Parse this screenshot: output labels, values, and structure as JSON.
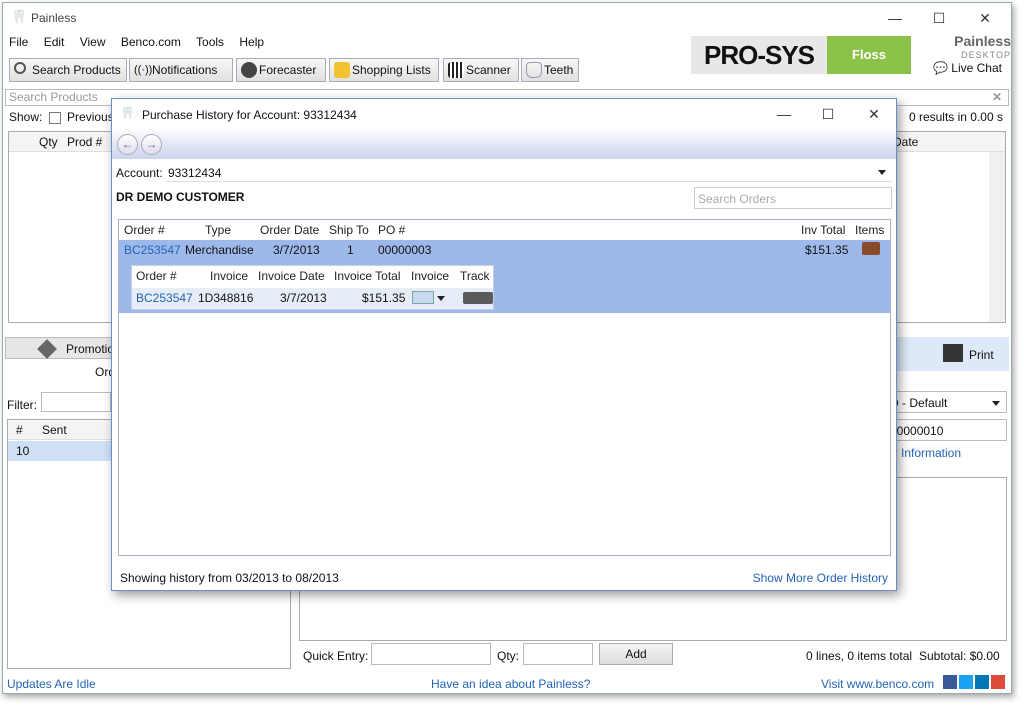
{
  "app": {
    "title": "Painless"
  },
  "window_controls": {
    "minimize": "—",
    "maximize": "☐",
    "close": "✕"
  },
  "menu": [
    "File",
    "Edit",
    "View",
    "Benco.com",
    "Tools",
    "Help"
  ],
  "toolbar": {
    "search_products": "Search Products",
    "notifications": "Notifications",
    "forecaster": "Forecaster",
    "shopping_lists": "Shopping Lists",
    "scanner": "Scanner",
    "teeth": "Teeth"
  },
  "banner": {
    "prosys": "PRO-SYS",
    "floss": "Floss",
    "painless": "Painless",
    "desktop": "DESKTOP",
    "live_chat": "Live Chat"
  },
  "search": {
    "placeholder": "Search Products",
    "results": "0 results in 0.00 s"
  },
  "show": {
    "label": "Show:",
    "previous": "Previous I"
  },
  "product_grid": {
    "qty": "Qty",
    "prod": "Prod #",
    "date": "Date"
  },
  "promotions": {
    "label": "Promotio",
    "order_label": "Ord"
  },
  "filter": {
    "label": "Filter:"
  },
  "sent_grid": {
    "hash": "#",
    "sent": "Sent",
    "row_num": "10"
  },
  "right_panel": {
    "print": "Print",
    "default_select": "D - Default",
    "number": "00000010",
    "info_link": "er Information"
  },
  "quick_entry": {
    "label": "Quick Entry:",
    "qty_label": "Qty:",
    "add": "Add",
    "totals": "0 lines, 0 items total",
    "subtotal": "Subtotal:  $0.00"
  },
  "status": {
    "updates": "Updates Are Idle",
    "idea": "Have an idea about Painless?",
    "visit": "Visit www.benco.com"
  },
  "dialog": {
    "title": "Purchase History for Account: 93312434",
    "account_label": "Account:",
    "account_value": "93312434",
    "customer": "DR DEMO CUSTOMER",
    "search_orders_placeholder": "Search Orders",
    "headers": {
      "order": "Order #",
      "type": "Type",
      "order_date": "Order Date",
      "ship_to": "Ship To",
      "po": "PO #",
      "inv_total": "Inv Total",
      "items": "Items"
    },
    "order": {
      "order": "BC253547",
      "type": "Merchandise",
      "order_date": "3/7/2013",
      "ship_to": "1",
      "po": "00000003",
      "inv_total": "$151.35"
    },
    "sub_headers": {
      "order": "Order #",
      "invoice": "Invoice",
      "invoice_date": "Invoice Date",
      "invoice_total": "Invoice Total",
      "invoice_col": "Invoice",
      "track": "Track"
    },
    "sub_row": {
      "order": "BC253547",
      "invoice": "1D348816",
      "invoice_date": "3/7/2013",
      "invoice_total": "$151.35"
    },
    "footer_text": "Showing history from 03/2013 to 08/2013",
    "more_link": "Show More Order History"
  },
  "colors": {
    "accent": "#2364b4",
    "selected_row": "#9db9ec",
    "floss_green": "#8dc24a"
  }
}
